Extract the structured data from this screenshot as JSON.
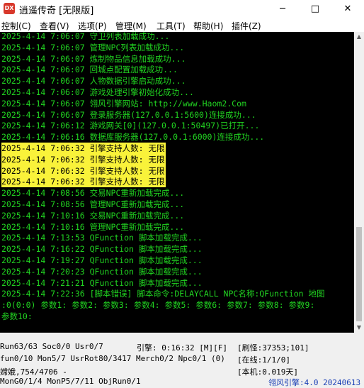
{
  "window": {
    "icon_text": "DX",
    "title": "逍遥传奇 [无限版]",
    "minimize": "─",
    "maximize": "□",
    "close": "✕"
  },
  "menu": [
    {
      "label": "控制(C)"
    },
    {
      "label": "查看(V)"
    },
    {
      "label": "选项(P)"
    },
    {
      "label": "管理(M)"
    },
    {
      "label": "工具(T)"
    },
    {
      "label": "帮助(H)"
    },
    {
      "label": "插件(Z)"
    }
  ],
  "log": [
    {
      "text": "2025-4-14  7:06:07 守卫列表加载成功...",
      "highlight": false
    },
    {
      "text": "2025-4-14  7:06:07 管理NPC列表加载成功...",
      "highlight": false
    },
    {
      "text": "2025-4-14  7:06:07 炼制物品信息加载成功...",
      "highlight": false
    },
    {
      "text": "2025-4-14  7:06:07 回城点配置加载成功...",
      "highlight": false
    },
    {
      "text": "2025-4-14  7:06:07 人物数据引擎启动成功...",
      "highlight": false
    },
    {
      "text": "2025-4-14  7:06:07 游戏处理引擎初始化成功...",
      "highlight": false
    },
    {
      "text": "2025-4-14  7:06:07 翎风引擎网站: http://www.Haom2.Com",
      "highlight": false
    },
    {
      "text": "2025-4-14  7:06:07 登录服务器(127.0.0.1:5600)连接成功...",
      "highlight": false
    },
    {
      "text": "2025-4-14  7:06:12 游戏网关[0](127.0.0.1:50497)已打开...",
      "highlight": false
    },
    {
      "text": "2025-4-14  7:06:16 数据库服务器(127.0.0.1:6000)连接成功...",
      "highlight": false
    },
    {
      "text": "2025-4-14  7:06:32 引擎支持人数: 无限",
      "highlight": true
    },
    {
      "text": "2025-4-14  7:06:32 引擎支持人数: 无限",
      "highlight": true
    },
    {
      "text": "2025-4-14  7:06:32 引擎支持人数: 无限",
      "highlight": true
    },
    {
      "text": "2025-4-14  7:06:32 引擎支持人数: 无限",
      "highlight": true
    },
    {
      "text": "2025-4-14  7:08:56 交易NPC重新加载完成...",
      "highlight": false
    },
    {
      "text": "2025-4-14  7:08:56 管理NPC重新加载完成...",
      "highlight": false
    },
    {
      "text": "2025-4-14  7:10:16 交易NPC重新加载完成...",
      "highlight": false
    },
    {
      "text": "2025-4-14  7:10:16 管理NPC重新加载完成...",
      "highlight": false
    },
    {
      "text": "2025-4-14  7:13:53 QFunction 脚本加载完成...",
      "highlight": false
    },
    {
      "text": "2025-4-14  7:16:22 QFunction 脚本加载完成...",
      "highlight": false
    },
    {
      "text": "2025-4-14  7:19:27 QFunction 脚本加载完成...",
      "highlight": false
    },
    {
      "text": "2025-4-14  7:20:23 QFunction 脚本加载完成...",
      "highlight": false
    },
    {
      "text": "2025-4-14  7:21:21 QFunction 脚本加载完成...",
      "highlight": false
    },
    {
      "text": "2025-4-14  7:22:36 [脚本错误]  脚本命令:DELAYCALL NPC名称:QFunction 地图",
      "highlight": false
    },
    {
      "text": ":0(0:0) 参数1: 参数2: 参数3: 参数4: 参数5: 参数6: 参数7: 参数8: 参数9:",
      "highlight": false
    },
    {
      "text": "参数10:",
      "highlight": false
    }
  ],
  "scrollbar": {
    "up": "▲",
    "down": "▼"
  },
  "status": {
    "row1_left": "Run63/63 Soc0/0 Usr0/7",
    "row1_mid": "引擎: 0:16:32 [M][F]",
    "row1_right": "[刷怪:37353;101]",
    "row2_left": "fun0/10 Mon5/7 UsrRot80/3417 Merch0/2 Npc0/1 (0)",
    "row2_right": "[在线:1/1/0]",
    "row3_left": "嫦娥,754/4706 -",
    "row3_right": "[本机:0.019天]",
    "row4_left": "MonG0/1/4 MonP5/7/11 ObjRun0/1",
    "row4_right": "翎风引擎:4.0 20240613"
  }
}
